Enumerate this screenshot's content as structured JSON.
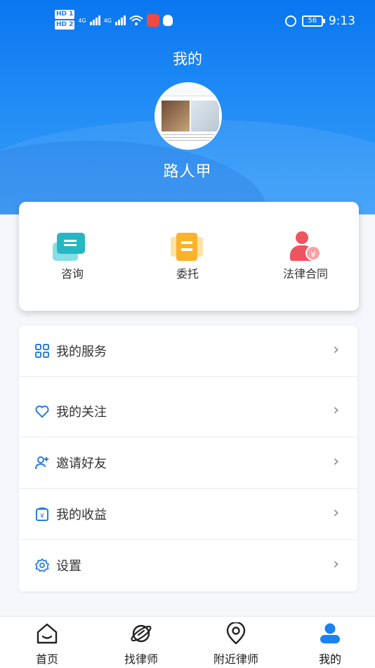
{
  "status_bar": {
    "hd1": "HD 1",
    "hd2": "HD 2",
    "net1": "4G",
    "net2": "4G",
    "battery": "56",
    "time": "9:13"
  },
  "header": {
    "title": "我的",
    "username": "路人甲"
  },
  "quick_actions": [
    {
      "label": "咨询",
      "icon": "chat-bubbles-icon"
    },
    {
      "label": "委托",
      "icon": "document-icon"
    },
    {
      "label": "法律合同",
      "icon": "person-yuan-icon"
    }
  ],
  "menu": [
    {
      "label": "我的服务",
      "icon": "grid-icon"
    },
    {
      "label": "我的关注",
      "icon": "heart-icon"
    },
    {
      "label": "邀请好友",
      "icon": "add-user-icon"
    },
    {
      "label": "我的收益",
      "icon": "wallet-yuan-icon"
    },
    {
      "label": "设置",
      "icon": "gear-icon"
    }
  ],
  "tabbar": [
    {
      "label": "首页",
      "icon": "home-icon"
    },
    {
      "label": "找律师",
      "icon": "planet-icon"
    },
    {
      "label": "附近律师",
      "icon": "location-pin-icon"
    },
    {
      "label": "我的",
      "icon": "profile-icon",
      "active": true
    }
  ],
  "colors": {
    "brand_blue": "#1a82f2",
    "icon_blue": "#2a7de1",
    "consult_teal": "#26b7c4",
    "entrust_orange": "#f9b22a",
    "contract_red": "#ec5560"
  }
}
